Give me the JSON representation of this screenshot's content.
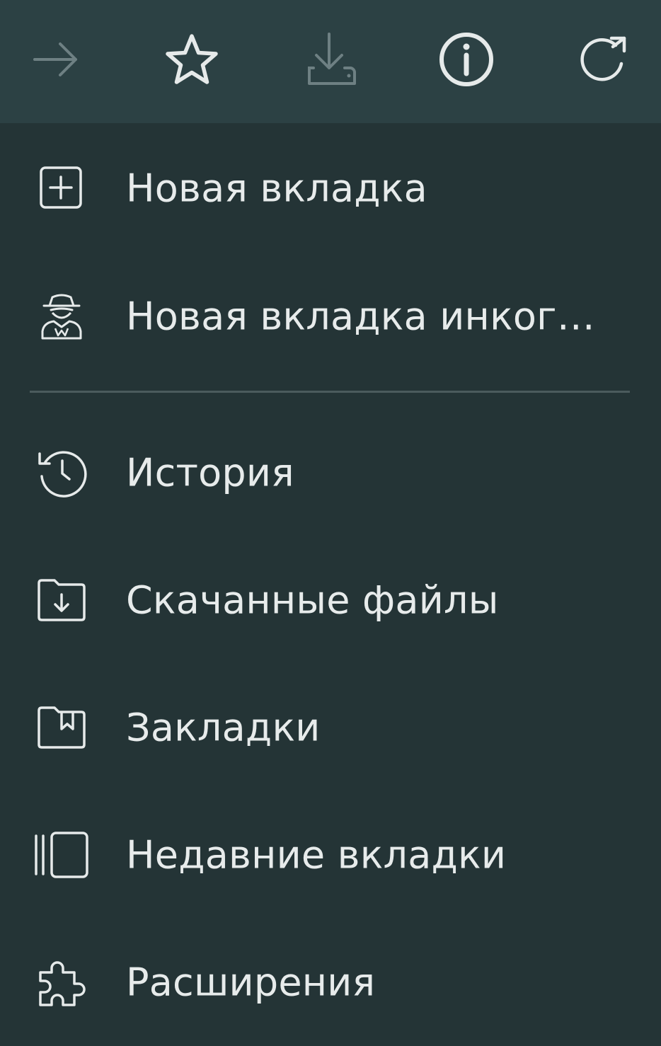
{
  "colors": {
    "toolbar_bg": "#2c4144",
    "menu_bg": "#243436",
    "icon_active": "#e6eaea",
    "icon_disabled": "#6e8083",
    "text": "#e7ebeb",
    "divider": "#4b5b5d"
  },
  "toolbar": {
    "buttons": [
      {
        "id": "forward",
        "icon": "arrow-right-icon",
        "enabled": false
      },
      {
        "id": "bookmark",
        "icon": "star-outline-icon",
        "enabled": true
      },
      {
        "id": "download",
        "icon": "download-tray-icon",
        "enabled": false
      },
      {
        "id": "info",
        "icon": "info-circle-icon",
        "enabled": true
      },
      {
        "id": "reload",
        "icon": "reload-icon",
        "enabled": true
      }
    ]
  },
  "menu": {
    "new_tab": {
      "label": "Новая вкладка",
      "icon": "plus-square-icon"
    },
    "incognito_tab": {
      "label": "Новая вкладка инког…",
      "icon": "incognito-icon"
    },
    "history": {
      "label": "История",
      "icon": "history-icon"
    },
    "downloads": {
      "label": "Скачанные файлы",
      "icon": "folder-download-icon"
    },
    "bookmarks": {
      "label": "Закладки",
      "icon": "folder-bookmark-icon"
    },
    "recent_tabs": {
      "label": "Недавние вкладки",
      "icon": "recent-tabs-icon"
    },
    "extensions": {
      "label": "Расширения",
      "icon": "puzzle-icon"
    }
  }
}
